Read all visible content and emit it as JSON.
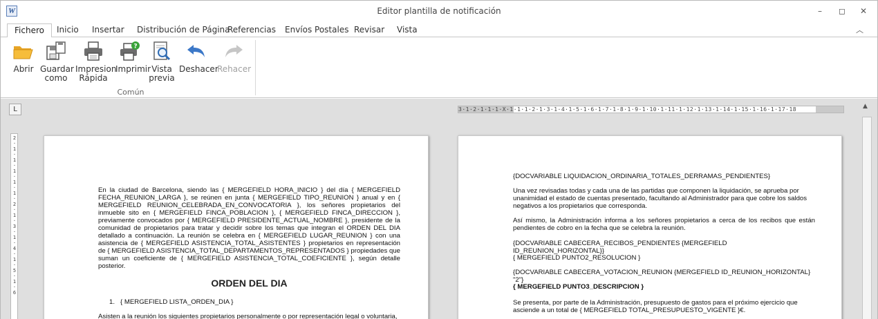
{
  "window": {
    "title": "Editor plantilla de notificación",
    "app_icon": "W"
  },
  "window_controls": {
    "minimize": "–",
    "maximize": "◻",
    "close": "✕"
  },
  "tabs": [
    "Fichero",
    "Inicio",
    "Insertar",
    "Distribución de Página",
    "Referencias",
    "Envíos Postales",
    "Revisar",
    "Vista"
  ],
  "collapse_glyph": "︿",
  "ribbon": {
    "buttons": [
      {
        "line1": "Abrir",
        "line2": "",
        "icon": "folder-open-icon"
      },
      {
        "line1": "Guardar",
        "line2": "como",
        "icon": "save-as-icon"
      },
      {
        "line1": "Impresion",
        "line2": "Rápida",
        "icon": "quick-print-icon"
      },
      {
        "line1": "Imprimir",
        "line2": "",
        "icon": "print-icon"
      },
      {
        "line1": "Vista",
        "line2": "previa",
        "icon": "print-preview-icon"
      },
      {
        "line1": "Deshacer",
        "line2": "",
        "icon": "undo-icon"
      },
      {
        "line1": "Rehacer",
        "line2": "",
        "icon": "redo-icon"
      }
    ],
    "group_label": "Común"
  },
  "ruler": {
    "corner": "L",
    "horizontal": "3·1·2·1·1·1·X·1·1·1·2·1·3·1·4·1·5·1·6·1·7·1·8·1·9·1·10·1·11·1·12·1·13·1·14·1·15·1·16·1·17·18",
    "vertical": "2·1·1·1·1·1·2·1·3·1·4·1·5·1·6"
  },
  "page1": {
    "paragraph1": "En la ciudad de Barcelona, siendo las { MERGEFIELD HORA_INICIO } del día { MERGEFIELD FECHA_REUNION_LARGA }, se reúnen en junta { MERGEFIELD TIPO_REUNION } anual y en { MERGEFIELD REUNION_CELEBRADA_EN_CONVOCATORIA }, los señores propietarios del inmueble sito en { MERGEFIELD FINCA_POBLACION }, { MERGEFIELD FINCA_DIRECCION }, previamente convocados por { MERGEFIELD PRESIDENTE_ACTUAL_NOMBRE }, presidente de la comunidad de propietarios para tratar y decidir sobre los temas que integran el ORDEN DEL DIA detallado a continuación. La reunión se celebra en { MERGEFIELD LUGAR_REUNION } con una asistencia de { MERGEFIELD ASISTENCIA_TOTAL_ASISTENTES } propietarios en representación de { MERGEFIELD ASISTENCIA_TOTAL_DEPARTAMENTOS_REPRESENTADOS } propiedades que suman un coeficiente de { MERGEFIELD ASISTENCIA_TOTAL_COEFICIENTE }, según detalle posterior.",
    "heading": "ORDEN DEL DIA",
    "list_number": "1.",
    "list_item": "{ MERGEFIELD LISTA_ORDEN_DIA }",
    "paragraph2": "Asisten a la reunión los siguientes propietarios personalmente o por representación legal o voluntaria,"
  },
  "page2": {
    "line1": "{DOCVARIABLE LIQUIDACION_ORDINARIA_TOTALES_DERRAMAS_PENDIENTES}",
    "para1": "Una vez revisadas todas y cada una de las partidas que componen la liquidación, se aprueba por unanimidad el estado de cuentas presentado, facultando al Administrador para que cobre los saldos negativos a los propietarios que corresponda.",
    "para2": "Así mismo, la Administración informa a los señores propietarios a cerca de los recibos que están pendientes de cobro en la fecha que se celebra la reunión.",
    "line2": "{DOCVARIABLE CABECERA_RECIBOS_PENDIENTES {MERGEFIELD ID_REUNION_HORIZONTAL}}",
    "line3": "{ MERGEFIELD PUNTO2_RESOLUCION }",
    "line4": "{DOCVARIABLE CABECERA_VOTACION_REUNION {MERGEFIELD ID_REUNION_HORIZONTAL} \"2\"}",
    "line5": "{ MERGEFIELD PUNTO3_DESCRIPCION }",
    "para3": "Se presenta, por parte de la Administración, presupuesto de gastos para el próximo ejercicio que asciende a un total de { MERGEFIELD TOTAL_PRESUPUESTO_VIGENTE }€."
  }
}
